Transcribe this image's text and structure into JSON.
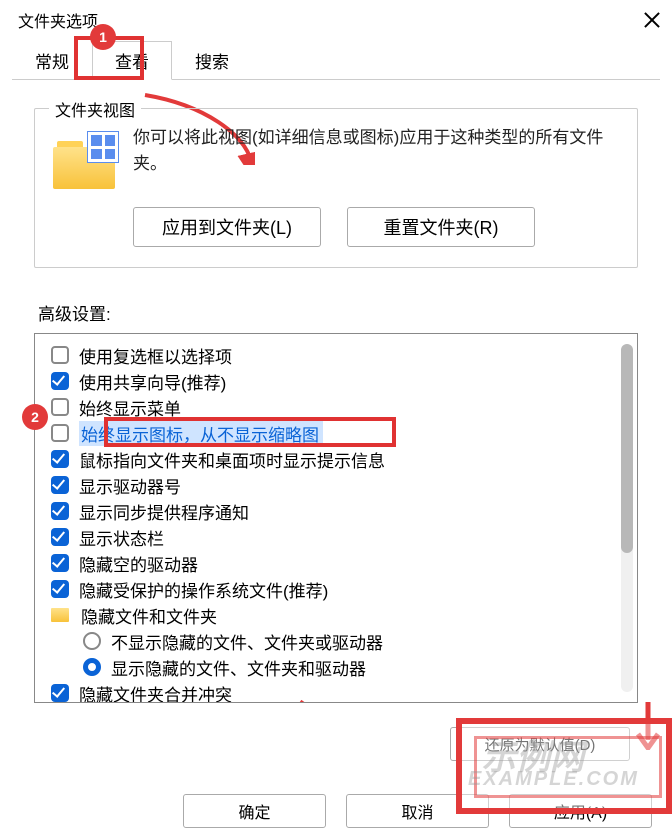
{
  "window": {
    "title": "文件夹选项"
  },
  "tabs": {
    "general": "常规",
    "view": "查看",
    "search": "搜索"
  },
  "folder_views": {
    "legend": "文件夹视图",
    "desc": "你可以将此视图(如详细信息或图标)应用于这种类型的所有文件夹。",
    "apply_btn": "应用到文件夹(L)",
    "reset_btn": "重置文件夹(R)"
  },
  "adv_label": "高级设置:",
  "adv": {
    "i1": "使用复选框以选择项",
    "i2": "使用共享向导(推荐)",
    "i3": "始终显示菜单",
    "i4": "始终显示图标，从不显示缩略图",
    "i5": "鼠标指向文件夹和桌面项时显示提示信息",
    "i6": "显示驱动器号",
    "i7": "显示同步提供程序通知",
    "i8": "显示状态栏",
    "i9": "隐藏空的驱动器",
    "i10": "隐藏受保护的操作系统文件(推荐)",
    "i11": "隐藏文件和文件夹",
    "i12": "不显示隐藏的文件、文件夹或驱动器",
    "i13": "显示隐藏的文件、文件夹和驱动器",
    "i14": "隐藏文件夹合并冲突"
  },
  "restore_btn": "还原为默认值(D)",
  "footer": {
    "ok": "确定",
    "cancel": "取消",
    "apply": "应用(A)"
  },
  "callouts": {
    "c1": "1",
    "c2": "2"
  }
}
